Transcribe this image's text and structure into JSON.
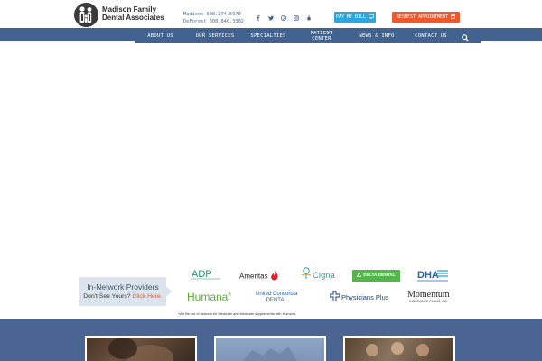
{
  "brand": {
    "name_line1": "Madison Family",
    "name_line2": "Dental Associates",
    "logo_icon": "family-figures-icon"
  },
  "contact": {
    "madison": "Madison 608.274.5970",
    "deforest": "DeForest 608.846.3302"
  },
  "social": [
    {
      "name": "facebook-icon"
    },
    {
      "name": "twitter-icon"
    },
    {
      "name": "pinterest-icon"
    },
    {
      "name": "instagram-icon"
    },
    {
      "name": "youtube-icon"
    }
  ],
  "buttons": {
    "pay": "PAY MY BILL",
    "appointment": "REQUEST APPOINTMENT"
  },
  "nav": {
    "about": "ABOUT US",
    "services": "OUR SERVICES",
    "specialties": "SPECIALTIES",
    "patient_1": "PATIENT",
    "patient_2": "CENTER",
    "news": "NEWS & INFO",
    "contact": "CONTACT US"
  },
  "providers": {
    "title": "In-Network Providers",
    "sub": "Don't See Yours?",
    "link": "Click Here."
  },
  "insurers": {
    "adp": "ADP",
    "ameritas": "Ameritas",
    "cigna": "Cigna",
    "delta": "DELTA DENTAL",
    "dha": "DHA",
    "humana": "Humana",
    "uc_1": "United Concordia",
    "uc_2": "DENTAL",
    "physicians": "Physicians Plus",
    "momentum_1": "Momentum",
    "momentum_2": "INSURANCE PLANS, INC"
  },
  "disclaimer": "*We file out of network for Medicare and Medicare supplements with Humana.",
  "colors": {
    "nav": "#42628f",
    "pay": "#2ba6de",
    "appointment": "#f0582c",
    "band": "#4a6591"
  }
}
